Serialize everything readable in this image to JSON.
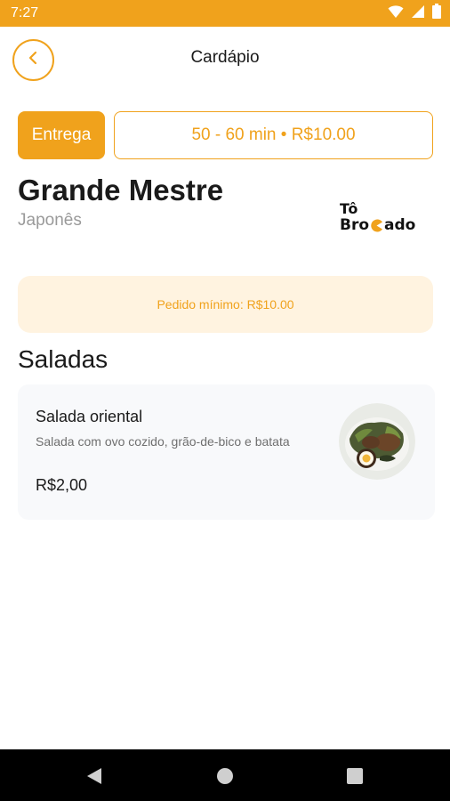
{
  "status_bar": {
    "time": "7:27",
    "icons": [
      "wifi-icon",
      "signal-icon",
      "battery-icon"
    ],
    "color": "#f0a21c"
  },
  "header": {
    "title": "Cardápio",
    "back_icon": "chevron-left-icon"
  },
  "delivery": {
    "mode_label": "Entrega",
    "info": "50 - 60 min • R$10.00"
  },
  "restaurant": {
    "name": "Grande Mestre",
    "category": "Japonês",
    "logo_line1": "Tô",
    "logo_line2_a": "Bro",
    "logo_line2_b": "ado"
  },
  "min_order": {
    "text": "Pedido mínimo: R$10.00"
  },
  "section": {
    "title": "Saladas"
  },
  "products": [
    {
      "name": "Salada oriental",
      "description": "Salada com ovo cozido, grão-de-bico e batata",
      "price": "R$2,00"
    }
  ],
  "nav_bar": {
    "icons": [
      "back-triangle-icon",
      "home-circle-icon",
      "recents-square-icon"
    ]
  },
  "colors": {
    "accent": "#f0a21c",
    "accent_light": "#fff3e0",
    "card_bg": "#f8f9fb"
  }
}
